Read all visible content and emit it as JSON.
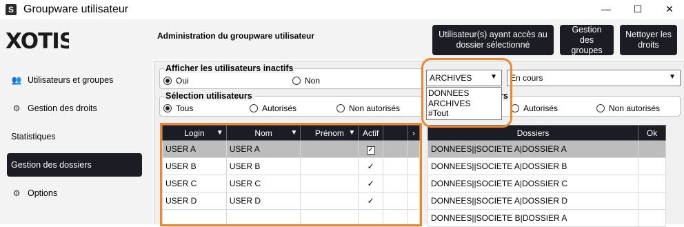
{
  "window": {
    "title": "Groupware utilisateur",
    "app_icon_letter": "S"
  },
  "window_controls": {
    "minimize": "—",
    "maximize": "☐",
    "close": "✕"
  },
  "logo": {
    "text": "XOTIS"
  },
  "sidebar": {
    "items": [
      {
        "label": "Utilisateurs et groupes",
        "icon": "users-icon",
        "glyph": "👥",
        "active": false
      },
      {
        "label": "Gestion des droits",
        "icon": "gear-icon",
        "glyph": "⚙",
        "active": false
      },
      {
        "label": "Statistiques",
        "icon": "",
        "glyph": "",
        "active": false
      },
      {
        "label": "Gestion des dossiers",
        "icon": "",
        "glyph": "",
        "active": true
      },
      {
        "label": "Options",
        "icon": "gear-icon",
        "glyph": "⚙",
        "active": false
      }
    ]
  },
  "header": {
    "title": "Administration du groupware utilisateur",
    "buttons": [
      {
        "line1": "Utilisateur(s) ayant accès au",
        "line2": "dossier sélectionné"
      },
      {
        "line1": "Gestion des",
        "line2": "groupes"
      },
      {
        "line1": "Nettoyer les",
        "line2": "droits"
      }
    ]
  },
  "inactive_users": {
    "legend": "Afficher les utilisateurs inactifs",
    "options": [
      "Oui",
      "Non"
    ],
    "selected": "Oui"
  },
  "user_selection": {
    "legend": "Sélection utilisateurs",
    "options": [
      "Tous",
      "Autorisés",
      "Non autorisés"
    ],
    "selected": "Tous"
  },
  "folder_selection": {
    "legend_suffix": "rs",
    "options": [
      "Autorisés",
      "Non autorisés"
    ]
  },
  "archive_select": {
    "value": "ARCHIVES",
    "options": [
      "DONNEES",
      "ARCHIVES",
      "#Tout"
    ]
  },
  "status_select": {
    "value": "En cours"
  },
  "users_table": {
    "columns": [
      "Login",
      "Nom",
      "Prénom",
      "Actif"
    ],
    "rows": [
      {
        "login": "USER A",
        "nom": "USER A",
        "prenom": "",
        "actif": "✓",
        "selected": true
      },
      {
        "login": "USER B",
        "nom": "USER B",
        "prenom": "",
        "actif": "✓",
        "selected": false
      },
      {
        "login": "USER C",
        "nom": "USER C",
        "prenom": "",
        "actif": "✓",
        "selected": false
      },
      {
        "login": "USER D",
        "nom": "USER D",
        "prenom": "",
        "actif": "✓",
        "selected": false
      }
    ]
  },
  "folders_table": {
    "columns": [
      "Dossiers",
      "Ok"
    ],
    "rows": [
      {
        "dossier": "DONNEES||SOCIETE A|DOSSIER A",
        "selected": true
      },
      {
        "dossier": "DONNEES||SOCIETE A|DOSSIER B",
        "selected": false
      },
      {
        "dossier": "DONNEES||SOCIETE A|DOSSIER C",
        "selected": false
      },
      {
        "dossier": "DONNEES||SOCIETE A|DOSSIER D",
        "selected": false
      },
      {
        "dossier": "DONNEES||SOCIETE B|DOSSIER A",
        "selected": false
      }
    ]
  },
  "colors": {
    "dark": "#1c1c24",
    "highlight": "#f0862c",
    "selected_row": "#bdbdbd"
  }
}
